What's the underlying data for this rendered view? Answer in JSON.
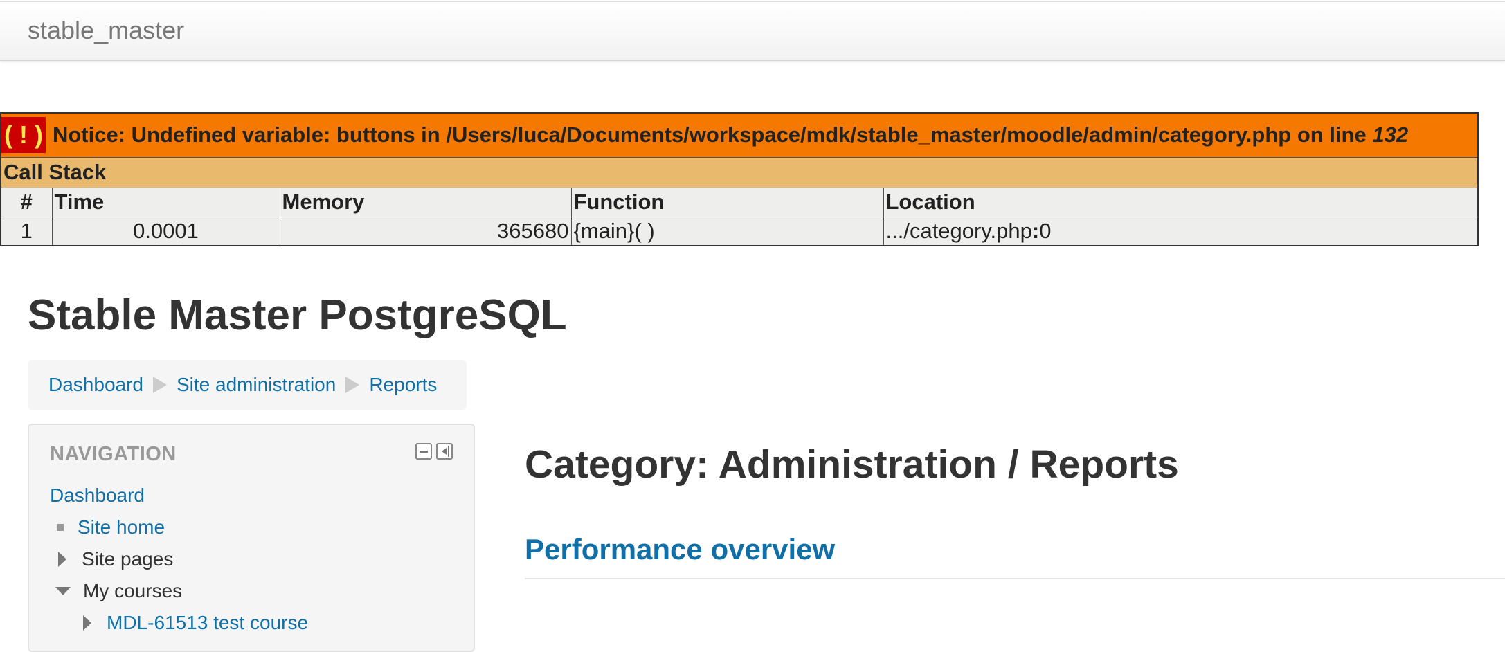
{
  "navbar": {
    "brand": "stable_master"
  },
  "xdebug": {
    "icon_text": "( ! )",
    "notice_text": "Notice: Undefined variable: buttons in /Users/luca/Documents/workspace/mdk/stable_master/moodle/admin/category.php on line ",
    "notice_line": "132",
    "call_stack_label": "Call Stack",
    "columns": [
      "#",
      "Time",
      "Memory",
      "Function",
      "Location"
    ],
    "rows": [
      {
        "num": "1",
        "time": "0.0001",
        "memory": "365680",
        "function": "{main}( )",
        "location_path": ".../category.php",
        "location_sep": ":",
        "location_line": "0"
      }
    ],
    "colors": {
      "notice_bg": "#f57900",
      "icon_bg": "#cc0000",
      "icon_fg": "#fce94f",
      "callstack_bg": "#e9b96e",
      "cell_bg": "#eeeeec"
    }
  },
  "page": {
    "site_title": "Stable Master PostgreSQL",
    "breadcrumb": [
      "Dashboard",
      "Site administration",
      "Reports"
    ]
  },
  "navigation": {
    "header": "NAVIGATION",
    "items": [
      {
        "label": "Dashboard",
        "icon": "none",
        "link": true
      },
      {
        "label": "Site home",
        "icon": "bullet-icon",
        "link": true
      },
      {
        "label": "Site pages",
        "icon": "collapsed-arrow-icon",
        "link": false
      },
      {
        "label": "My courses",
        "icon": "expanded-arrow-icon",
        "link": false
      },
      {
        "label": "MDL-61513 test course",
        "icon": "collapsed-arrow-icon",
        "link": true
      }
    ]
  },
  "main": {
    "title": "Category: Administration / Reports",
    "section_link": "Performance overview"
  },
  "colors": {
    "link": "#0f6fa6",
    "text": "#333333",
    "muted": "#999999"
  }
}
